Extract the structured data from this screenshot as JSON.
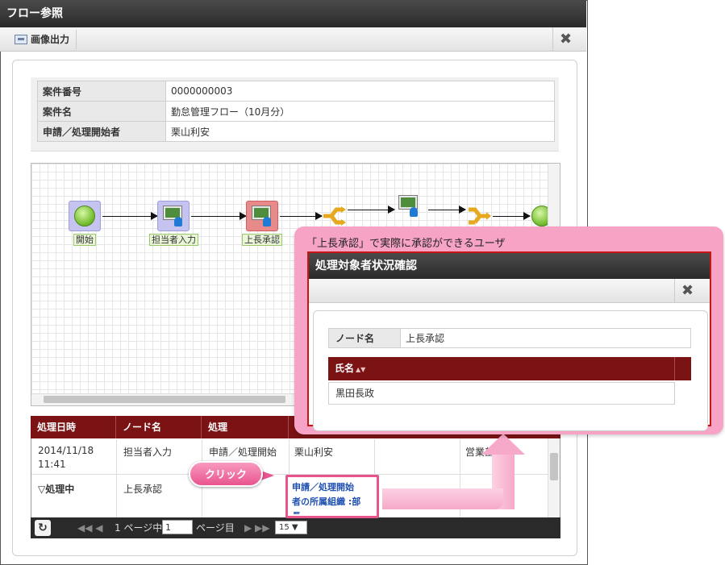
{
  "window": {
    "title": "フロー参照",
    "toolbar": {
      "export_label": "画像出力",
      "close_glyph": "✖"
    }
  },
  "info": {
    "rows": [
      {
        "key": "案件番号",
        "value": "0000000003"
      },
      {
        "key": "案件名",
        "value": "勤怠管理フロー（10月分）"
      },
      {
        "key": "申請／処理開始者",
        "value": "栗山利安"
      }
    ]
  },
  "diagram": {
    "nodes": [
      {
        "label": "開始",
        "kind": "start-circle"
      },
      {
        "label": "担当者入力",
        "kind": "task-user",
        "color": "#c5c3ef"
      },
      {
        "label": "上長承認",
        "kind": "task-user",
        "color": "#e98a8a"
      }
    ]
  },
  "history": {
    "columns": [
      "処理日時",
      "ノード名",
      "処理"
    ],
    "rows": [
      {
        "date": "2014/11/18",
        "time": "11:41",
        "node": "担当者入力",
        "action": "申請／処理開始",
        "user": "栗山利安",
        "dept": "営業部"
      },
      {
        "date": "▽処理中",
        "time": "",
        "node": "上長承認",
        "action": "",
        "user": "",
        "dept": ""
      }
    ],
    "link_text": [
      "申請／処理開始",
      "者の所属組織 :部",
      "長"
    ]
  },
  "pager": {
    "refresh_glyph": "↻",
    "first_prev": "◀◀ ◀",
    "page_prefix": "1 ページ中",
    "page_value": "1",
    "page_suffix": "ページ目",
    "next_last": "▶ ▶▶",
    "page_size": "15 ▼"
  },
  "callouts": {
    "click_label": "クリック",
    "popup_note": "「上長承認」で実際に承認ができるユーザ"
  },
  "popup": {
    "title": "処理対象者状況確認",
    "close_glyph": "✖",
    "node_key": "ノード名",
    "node_value": "上長承認",
    "user_header": "氏名",
    "sort_glyph": "▲▼",
    "users": [
      "黒田長政"
    ]
  }
}
